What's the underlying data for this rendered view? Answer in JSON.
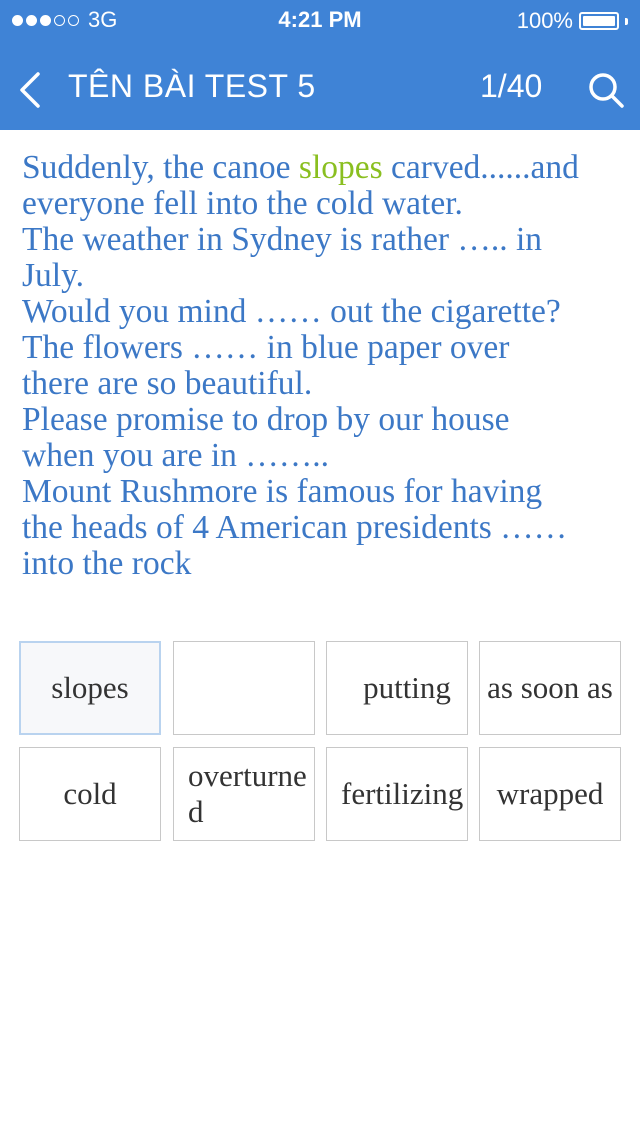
{
  "status_bar": {
    "carrier": "3G",
    "time": "4:21 PM",
    "battery": "100%",
    "signal_bars_filled": 3,
    "signal_bars_total": 5
  },
  "nav": {
    "title": "TÊN BÀI TEST 5",
    "progress": "1/40",
    "back_icon": "chevron-left-icon",
    "search_icon": "search-icon"
  },
  "question": {
    "lines": [
      [
        "Suddenly, the canoe ",
        "slopes",
        " carved......and"
      ],
      "everyone fell into the cold water.",
      "The weather in Sydney is rather ….. in",
      "July.",
      "Would you mind …… out the cigarette?",
      "The flowers ……  in blue paper over",
      "there are so beautiful.",
      "Please promise to drop by our house",
      "when you are in ……..",
      "Mount Rushmore is famous for having",
      "the heads of 4 American presidents ……",
      "into the rock"
    ]
  },
  "words": [
    {
      "label": "slopes",
      "selected": true
    },
    {
      "label": "",
      "selected": false
    },
    {
      "label": "putting",
      "selected": false
    },
    {
      "label": "as soon as",
      "selected": false
    },
    {
      "label": "cold",
      "selected": false
    },
    {
      "label": "overturned",
      "selected": false
    },
    {
      "label": "fertilizing",
      "selected": false
    },
    {
      "label": "wrapped",
      "selected": false
    }
  ],
  "colors": {
    "header": "#3f83d6",
    "question_text": "#3c78c6",
    "filled_answer": "#8abf20",
    "tile_text": "#333333",
    "tile_border": "#c8c8c8",
    "selected_border": "#b9d3ef"
  }
}
